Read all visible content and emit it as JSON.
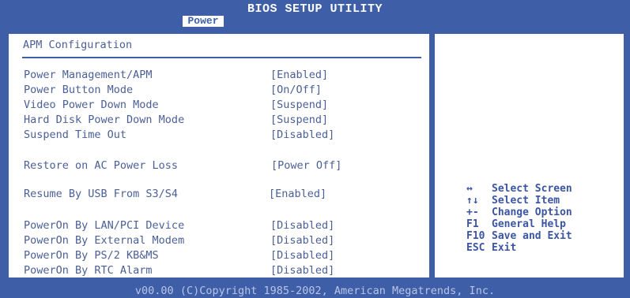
{
  "header": {
    "title": "BIOS SETUP UTILITY",
    "active_tab": "Power"
  },
  "main": {
    "section_title": "APM Configuration",
    "settings": [
      {
        "label": "Power Management/APM",
        "value": "[Enabled]"
      },
      {
        "label": "Power Button Mode",
        "value": "[On/Off]"
      },
      {
        "label": "Video Power Down Mode",
        "value": "[Suspend]"
      },
      {
        "label": "Hard Disk Power Down Mode",
        "value": "[Suspend]"
      },
      {
        "label": "Suspend Time Out",
        "value": "[Disabled]"
      },
      {
        "label": "Restore on AC Power Loss",
        "value": "[Power Off]"
      },
      {
        "label": "Resume By USB From S3/S4",
        "value": "[Enabled]"
      },
      {
        "label": "PowerOn By LAN/PCI Device",
        "value": "[Disabled]"
      },
      {
        "label": "PowerOn By External Modem",
        "value": "[Disabled]"
      },
      {
        "label": "PowerOn By PS/2 KB&MS",
        "value": "[Disabled]"
      },
      {
        "label": "PowerOn By RTC Alarm",
        "value": "[Disabled]"
      }
    ]
  },
  "help": {
    "keys": [
      {
        "key": "↔",
        "desc": "Select Screen"
      },
      {
        "key": "↑↓",
        "desc": "Select Item"
      },
      {
        "key": "+-",
        "desc": "Change Option"
      },
      {
        "key": "F1",
        "desc": "General Help"
      },
      {
        "key": "F10",
        "desc": "Save and Exit"
      },
      {
        "key": "ESC",
        "desc": "Exit"
      }
    ]
  },
  "footer": {
    "text": "v00.00 (C)Copyright 1985-2002, American Megatrends, Inc."
  }
}
